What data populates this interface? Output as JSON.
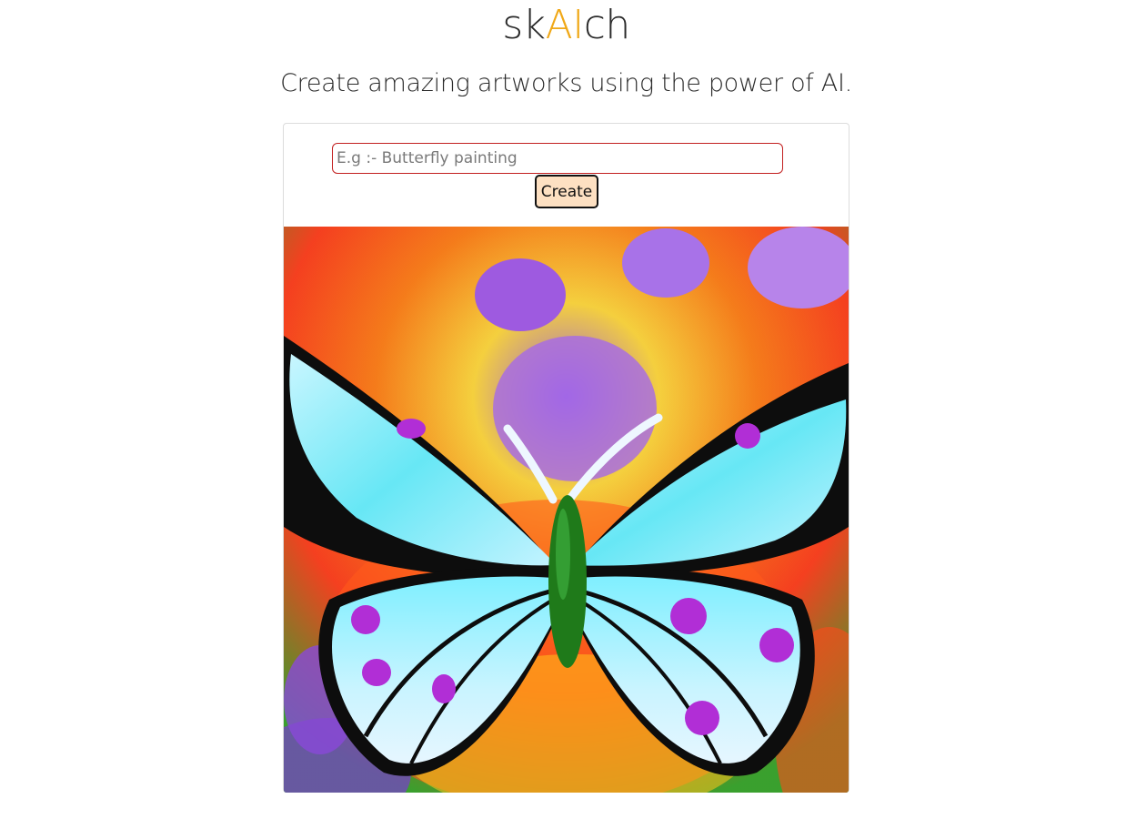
{
  "header": {
    "title_prefix": "sk",
    "title_highlight": "AI",
    "title_suffix": "ch",
    "tagline": "Create amazing artworks using the power of AI."
  },
  "form": {
    "prompt_placeholder": "E.g :- Butterfly painting",
    "prompt_value": "",
    "create_label": "Create"
  },
  "result": {
    "subject": "butterfly painting"
  },
  "colors": {
    "accent": "#f0a817",
    "button_bg": "#fde0c2",
    "input_border": "#c21f1f"
  }
}
